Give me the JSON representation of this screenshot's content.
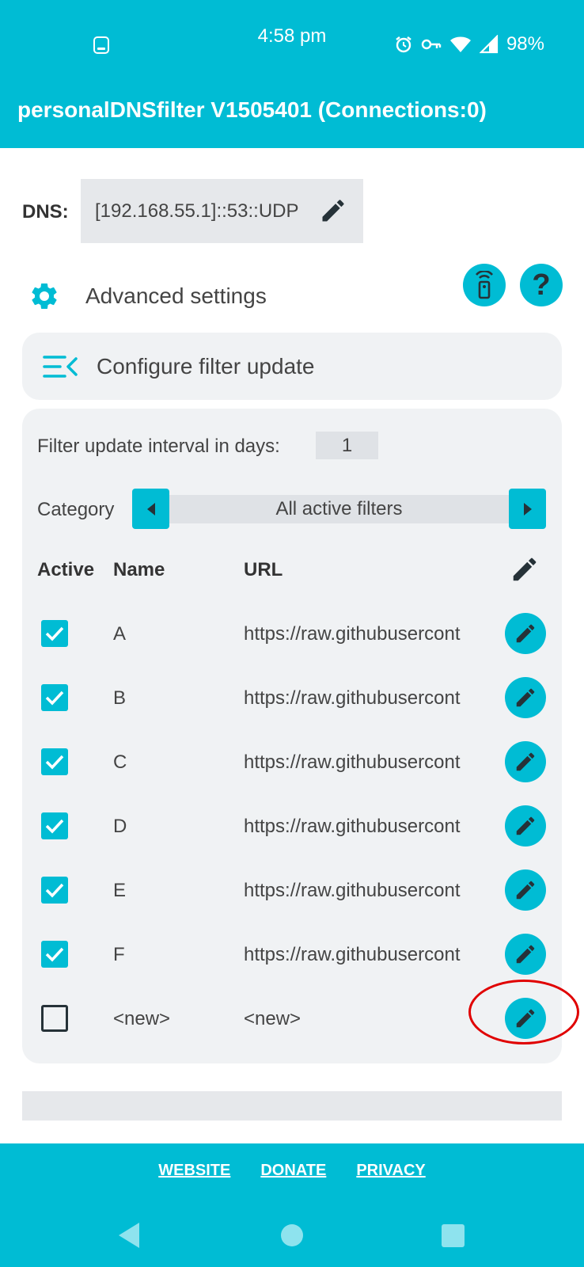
{
  "status_bar": {
    "time": "4:58 pm",
    "battery": "98%",
    "icons": [
      "screenshot-icon",
      "alarm-icon",
      "vpn-key-icon",
      "wifi-icon",
      "signal-icon"
    ]
  },
  "app_bar": {
    "title": "personalDNSfilter V1505401 (Connections:0)"
  },
  "dns": {
    "label": "DNS:",
    "value": "[192.168.55.1]::53::UDP"
  },
  "advanced": {
    "label": "Advanced settings"
  },
  "configure": {
    "label": "Configure filter update"
  },
  "filter_panel": {
    "interval_label": "Filter update interval in days:",
    "interval_value": "1",
    "category_label": "Category",
    "category_value": "All active filters",
    "columns": {
      "active": "Active",
      "name": "Name",
      "url": "URL"
    },
    "rows": [
      {
        "active": true,
        "name": "A",
        "url": "https://raw.githubusercont"
      },
      {
        "active": true,
        "name": "B",
        "url": "https://raw.githubusercont"
      },
      {
        "active": true,
        "name": "C",
        "url": "https://raw.githubusercont"
      },
      {
        "active": true,
        "name": "D",
        "url": "https://raw.githubusercont"
      },
      {
        "active": true,
        "name": "E",
        "url": "https://raw.githubusercont"
      },
      {
        "active": true,
        "name": "F",
        "url": "https://raw.githubusercont"
      },
      {
        "active": false,
        "name": "<new>",
        "url": "<new>"
      }
    ]
  },
  "footer": {
    "links": [
      "WEBSITE",
      "DONATE",
      "PRIVACY"
    ]
  },
  "colors": {
    "accent": "#00bcd4",
    "panel_bg": "#f0f2f4",
    "annotation": "#e00000"
  }
}
